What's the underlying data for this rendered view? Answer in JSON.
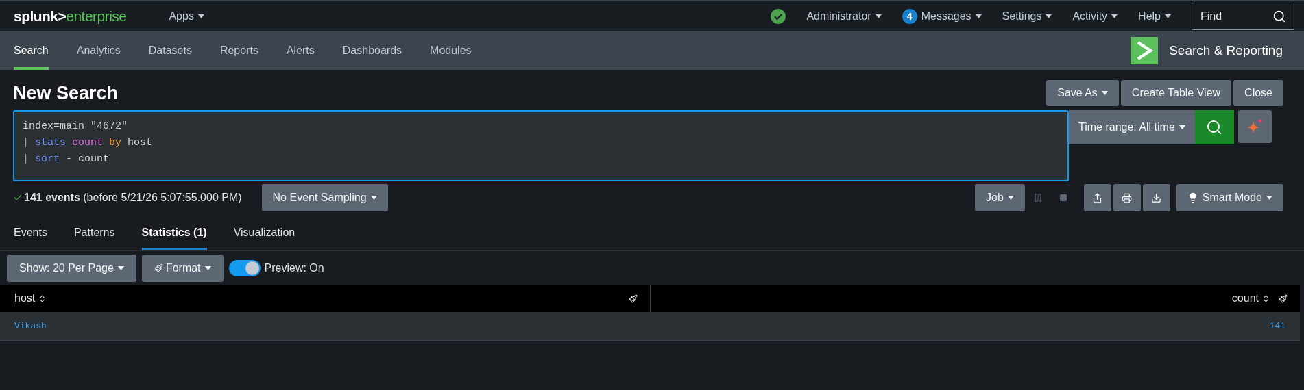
{
  "top_bar": {
    "logo": {
      "brand": "splunk>",
      "product": "enterprise"
    },
    "apps_menu": "Apps",
    "menus": [
      {
        "label": "Administrator"
      },
      {
        "label": "Messages",
        "badge": "4"
      },
      {
        "label": "Settings"
      },
      {
        "label": "Activity"
      },
      {
        "label": "Help"
      }
    ],
    "find": {
      "placeholder": "Find"
    }
  },
  "app_bar": {
    "tabs": [
      {
        "label": "Search",
        "selected": true
      },
      {
        "label": "Analytics",
        "selected": false
      },
      {
        "label": "Datasets",
        "selected": false
      },
      {
        "label": "Reports",
        "selected": false
      },
      {
        "label": "Alerts",
        "selected": false
      },
      {
        "label": "Dashboards",
        "selected": false
      },
      {
        "label": "Modules",
        "selected": false
      }
    ],
    "app_name": "Search & Reporting"
  },
  "page": {
    "title": "New Search",
    "actions": [
      "Save As",
      "Create Table View",
      "Close"
    ],
    "query_lines": [
      [
        {
          "text": "index=main \"4672\"",
          "kind": "plain"
        }
      ],
      [
        {
          "text": "| ",
          "kind": "pipe"
        },
        {
          "text": "stats ",
          "kind": "command"
        },
        {
          "text": "count ",
          "kind": "function"
        },
        {
          "text": "by",
          "kind": "keyword"
        },
        {
          "text": " host",
          "kind": "plain"
        }
      ],
      [
        {
          "text": "| ",
          "kind": "pipe"
        },
        {
          "text": "sort",
          "kind": "command"
        },
        {
          "text": " - count",
          "kind": "plain"
        }
      ]
    ],
    "time_range": "Time range: All time",
    "status": {
      "text": "**141 events** (before 5/21/26 5:07:55.000 PM)"
    },
    "sampling": "No Event Sampling",
    "job": "Job",
    "mode": "Smart Mode"
  },
  "result_tabs": [
    {
      "label": "Events",
      "selected": false
    },
    {
      "label": "Patterns",
      "selected": false
    },
    {
      "label": "Statistics (1)",
      "selected": true
    },
    {
      "label": "Visualization",
      "selected": false
    }
  ],
  "toolbar": {
    "page_size": "Show: 20 Per Page",
    "format": "Format",
    "preview": {
      "label": "Preview: On",
      "on": true
    }
  },
  "table": {
    "columns": [
      "host",
      "count"
    ],
    "rows": [
      [
        "Vikash",
        "141"
      ]
    ]
  }
}
